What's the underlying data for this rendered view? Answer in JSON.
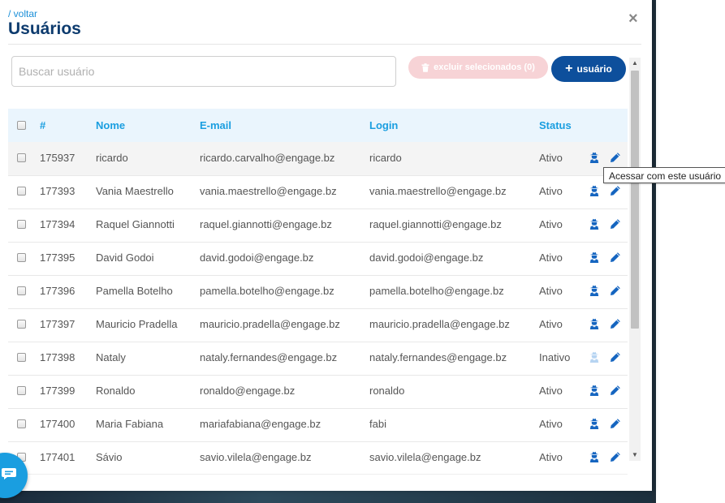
{
  "header": {
    "back_link": "/ voltar",
    "title": "Usuários",
    "close_glyph": "×"
  },
  "toolbar": {
    "search_placeholder": "Buscar usuário",
    "search_value": "",
    "delete_label": "excluir selecionados (0)",
    "add_label": "usuário"
  },
  "table": {
    "columns": [
      "#",
      "Nome",
      "E-mail",
      "Login",
      "Status"
    ],
    "rows": [
      {
        "id": "175937",
        "name": "ricardo",
        "email": "ricardo.carvalho@engage.bz",
        "login": "ricardo",
        "status": "Ativo"
      },
      {
        "id": "177393",
        "name": "Vania Maestrello",
        "email": "vania.maestrello@engage.bz",
        "login": "vania.maestrello@engage.bz",
        "status": "Ativo"
      },
      {
        "id": "177394",
        "name": "Raquel Giannotti",
        "email": "raquel.giannotti@engage.bz",
        "login": "raquel.giannotti@engage.bz",
        "status": "Ativo"
      },
      {
        "id": "177395",
        "name": "David Godoi",
        "email": "david.godoi@engage.bz",
        "login": "david.godoi@engage.bz",
        "status": "Ativo"
      },
      {
        "id": "177396",
        "name": "Pamella Botelho",
        "email": "pamella.botelho@engage.bz",
        "login": "pamella.botelho@engage.bz",
        "status": "Ativo"
      },
      {
        "id": "177397",
        "name": "Mauricio Pradella",
        "email": "mauricio.pradella@engage.bz",
        "login": "mauricio.pradella@engage.bz",
        "status": "Ativo"
      },
      {
        "id": "177398",
        "name": "Nataly",
        "email": "nataly.fernandes@engage.bz",
        "login": "nataly.fernandes@engage.bz",
        "status": "Inativo"
      },
      {
        "id": "177399",
        "name": "Ronaldo",
        "email": "ronaldo@engage.bz",
        "login": "ronaldo",
        "status": "Ativo"
      },
      {
        "id": "177400",
        "name": "Maria Fabiana",
        "email": "mariafabiana@engage.bz",
        "login": "fabi",
        "status": "Ativo"
      },
      {
        "id": "177401",
        "name": "Sávio",
        "email": "savio.vilela@engage.bz",
        "login": "savio.vilela@engage.bz",
        "status": "Ativo"
      }
    ]
  },
  "tooltip": {
    "text": "Acessar com este usuário"
  },
  "icons": {
    "impersonate": "user-secret-icon",
    "edit": "pencil-icon",
    "delete": "trash-icon",
    "add": "plus-icon",
    "close": "close-icon",
    "chat": "chat-icon"
  },
  "colors": {
    "title": "#0d3b6e",
    "link": "#1a8fd8",
    "header_text": "#1a9ee0",
    "header_bg": "#eaf5fd",
    "primary_button": "#0d4f9c",
    "delete_button_disabled": "#f7d3d6",
    "action_icon": "#1565c0",
    "action_icon_disabled": "#b6d4f2",
    "chat_bubble": "#1a9ee0"
  }
}
